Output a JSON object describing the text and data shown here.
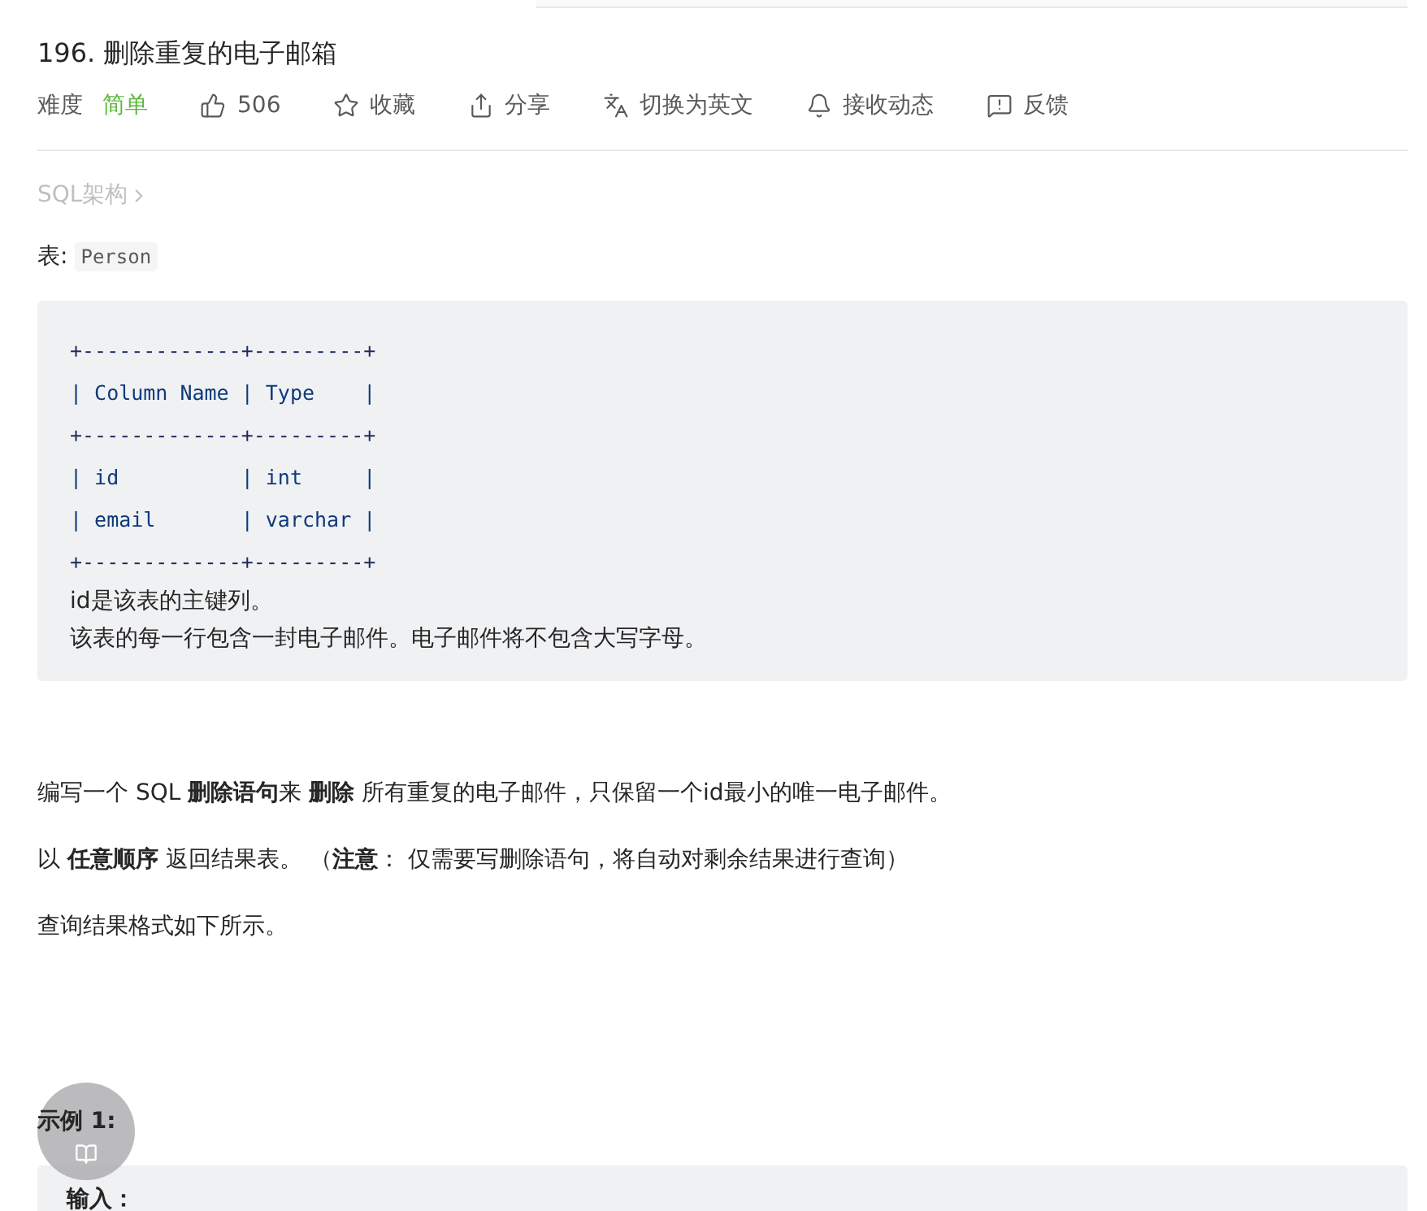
{
  "title": "196. 删除重复的电子邮箱",
  "meta": {
    "difficulty_label": "难度",
    "difficulty": "简单",
    "actions": [
      {
        "kind": "like",
        "label": "506"
      },
      {
        "kind": "star",
        "label": "收藏"
      },
      {
        "kind": "share",
        "label": "分享"
      },
      {
        "kind": "translate",
        "label": "切换为英文"
      },
      {
        "kind": "bell",
        "label": "接收动态"
      },
      {
        "kind": "feedback",
        "label": "反馈"
      }
    ]
  },
  "breadcrumb": "SQL架构",
  "table_label": "表:",
  "table_name": "Person",
  "schema_lines": [
    "+-------------+---------+",
    "| Column Name | Type    |",
    "+-------------+---------+",
    "| id          | int     |",
    "| email       | varchar |",
    "+-------------+---------+"
  ],
  "schema_notes": [
    "id是该表的主键列。",
    "该表的每一行包含一封电子邮件。电子邮件将不包含大写字母。"
  ],
  "paragraphs": [
    "编写一个 SQL **删除语句**来 **删除** 所有重复的电子邮件，只保留一个id最小的唯一电子邮件。",
    "以 **任意顺序** 返回结果表。 （**注意**： 仅需要写删除语句，将自动对剩余结果进行查询）",
    "查询结果格式如下所示。"
  ],
  "example_heading": "示例 1:",
  "example_first_line": "输入："
}
